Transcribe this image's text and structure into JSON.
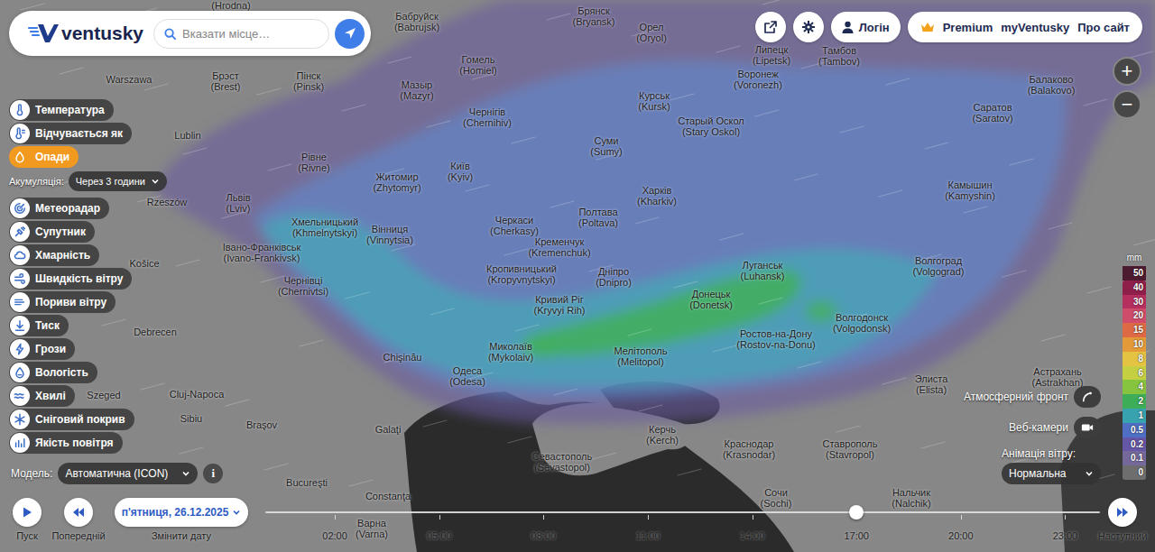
{
  "header": {
    "logo": "ventusky",
    "search": {
      "placeholder": "Вказати місце…"
    }
  },
  "topbar": {
    "login": "Логін",
    "links": [
      "Premium",
      "myVentusky",
      "Про сайт"
    ]
  },
  "zoom": [
    "+",
    "−"
  ],
  "sidebar": {
    "layers": [
      {
        "label": "Температура",
        "selected": false
      },
      {
        "label": "Відчувається як",
        "selected": false
      },
      {
        "label": "Опади",
        "selected": true,
        "option": {
          "label": "Акумуляція:",
          "value": "Через 3 години"
        }
      },
      {
        "label": "Метеорадар",
        "selected": false
      },
      {
        "label": "Супутник",
        "selected": false
      },
      {
        "label": "Хмарність",
        "selected": false
      },
      {
        "label": "Швидкість вітру",
        "selected": false
      },
      {
        "label": "Пориви вітру",
        "selected": false
      },
      {
        "label": "Тиск",
        "selected": false
      },
      {
        "label": "Грози",
        "selected": false
      },
      {
        "label": "Вологість",
        "selected": false
      },
      {
        "label": "Хвилі",
        "selected": false
      },
      {
        "label": "Сніговий покрив",
        "selected": false
      },
      {
        "label": "Якість повітря",
        "selected": false
      }
    ]
  },
  "model": {
    "label": "Модель:",
    "value": "Автоматична (ICON)",
    "info": "i"
  },
  "legend": {
    "unit": "mm",
    "steps": [
      {
        "value": "50",
        "color": "#4d1b2f"
      },
      {
        "value": "40",
        "color": "#8e1f4a"
      },
      {
        "value": "30",
        "color": "#b5305f"
      },
      {
        "value": "20",
        "color": "#cf4d6b"
      },
      {
        "value": "15",
        "color": "#de6a45"
      },
      {
        "value": "10",
        "color": "#e59a3a"
      },
      {
        "value": "8",
        "color": "#e4c343"
      },
      {
        "value": "6",
        "color": "#c5cf42"
      },
      {
        "value": "4",
        "color": "#86c43f"
      },
      {
        "value": "2",
        "color": "#3ead57"
      },
      {
        "value": "1",
        "color": "#38a3ae"
      },
      {
        "value": "0.5",
        "color": "#4f6fc4"
      },
      {
        "value": "0.2",
        "color": "#6656a6"
      },
      {
        "value": "0.1",
        "color": "#75689a"
      },
      {
        "value": "0",
        "color": "#6e6e6e"
      }
    ]
  },
  "overlays": {
    "front": {
      "label": "Атмосферний фронт",
      "on": false
    },
    "webcams": {
      "label": "Веб-камери",
      "on": false
    },
    "wind_animation": {
      "label": "Анімація вітру:",
      "value": "Нормальна"
    }
  },
  "timeline": {
    "play": "Пуск",
    "previous": "Попередній",
    "date": "п'ятниця, 26.12.2025",
    "change_date": "Змінити дату",
    "next": "Наступний",
    "ticks": [
      "02:00",
      "05:00",
      "08:00",
      "11:00",
      "14:00",
      "17:00",
      "20:00",
      "23:00"
    ],
    "level": 0.708
  },
  "cities": [
    {
      "name": "(Hrodna)"
    },
    {
      "name": "Бабруйск",
      "latin": "(Babrujsk)"
    },
    {
      "name": "Брянск",
      "latin": "(Bryansk)"
    },
    {
      "name": "Орел",
      "latin": "(Oryol)"
    },
    {
      "name": "Липецк",
      "latin": "(Lipetsk)"
    },
    {
      "name": "Тамбов",
      "latin": "(Tambov)"
    },
    {
      "name": "Балаково",
      "latin": "(Balakovo)"
    },
    {
      "name": "Warszawa"
    },
    {
      "name": "Брэст",
      "latin": "(Brest)"
    },
    {
      "name": "Пінск",
      "latin": "(Pinsk)"
    },
    {
      "name": "Гомель",
      "latin": "(Homiel)"
    },
    {
      "name": "Мазыр",
      "latin": "(Mazyr)"
    },
    {
      "name": "Чернігів",
      "latin": "(Chernihiv)"
    },
    {
      "name": "Курськ",
      "latin": "(Kursk)"
    },
    {
      "name": "Воронеж",
      "latin": "(Voronezh)"
    },
    {
      "name": "Старый Оскол",
      "latin": "(Stary Oskol)"
    },
    {
      "name": "Саратов",
      "latin": "(Saratov)"
    },
    {
      "name": "Lublin"
    },
    {
      "name": "Рівне",
      "latin": "(Rivne)"
    },
    {
      "name": "Житомир",
      "latin": "(Zhytomyr)"
    },
    {
      "name": "Київ",
      "latin": "(Kyiv)"
    },
    {
      "name": "Суми",
      "latin": "(Sumy)"
    },
    {
      "name": "Харків",
      "latin": "(Kharkiv)"
    },
    {
      "name": "Камышин",
      "latin": "(Kamyshin)"
    },
    {
      "name": "Rzeszów"
    },
    {
      "name": "Львів",
      "latin": "(Lviv)"
    },
    {
      "name": "Хмельницький",
      "latin": "(Khmelnytskyi)"
    },
    {
      "name": "Вінниця",
      "latin": "(Vinnytsia)"
    },
    {
      "name": "Черкаси",
      "latin": "(Cherkasy)"
    },
    {
      "name": "Полтава",
      "latin": "(Poltava)"
    },
    {
      "name": "Кременчук",
      "latin": "(Kremenchuk)"
    },
    {
      "name": "Луганськ",
      "latin": "(Luhansk)"
    },
    {
      "name": "Волгоград",
      "latin": "(Volgograd)"
    },
    {
      "name": "Івано-Франківськ",
      "latin": "(Ivano-Frankivsk)"
    },
    {
      "name": "Košice"
    },
    {
      "name": "Кропивницький",
      "latin": "(Kropyvnytskyi)"
    },
    {
      "name": "Дніпро",
      "latin": "(Dnipro)"
    },
    {
      "name": "Чернівці",
      "latin": "(Chernivtsi)"
    },
    {
      "name": "Кривий Ріг",
      "latin": "(Kryvyi Rih)"
    },
    {
      "name": "Донецьк",
      "latin": "(Donetsk)"
    },
    {
      "name": "Волгодонск",
      "latin": "(Volgodonsk)"
    },
    {
      "name": "Debrecen"
    },
    {
      "name": "Ростов-на-Дону",
      "latin": "(Rostov-na-Donu)"
    },
    {
      "name": "Миколаїв",
      "latin": "(Mykolaiv)"
    },
    {
      "name": "Мелітополь",
      "latin": "(Melitopol)"
    },
    {
      "name": "Chişinău"
    },
    {
      "name": "Одеса",
      "latin": "(Odesa)"
    },
    {
      "name": "Элиста",
      "latin": "(Elista)"
    },
    {
      "name": "Астрахань",
      "latin": "(Astrakhan)"
    },
    {
      "name": "Szeged"
    },
    {
      "name": "Cluj-Napoca"
    },
    {
      "name": "Sibiu"
    },
    {
      "name": "Braşov"
    },
    {
      "name": "Керчь",
      "latin": "(Kerch)"
    },
    {
      "name": "Galaţi"
    },
    {
      "name": "Краснодар",
      "latin": "(Krasnodar)"
    },
    {
      "name": "Ставрополь",
      "latin": "(Stavropol)"
    },
    {
      "name": "Севастополь",
      "latin": "(Sevastopol)"
    },
    {
      "name": "Bucureşti"
    },
    {
      "name": "Constanţa"
    },
    {
      "name": "Сочи",
      "latin": "(Sochi)"
    },
    {
      "name": "Нальчик",
      "latin": "(Nalchik)"
    },
    {
      "name": "Варна",
      "latin": "(Varna)"
    }
  ]
}
